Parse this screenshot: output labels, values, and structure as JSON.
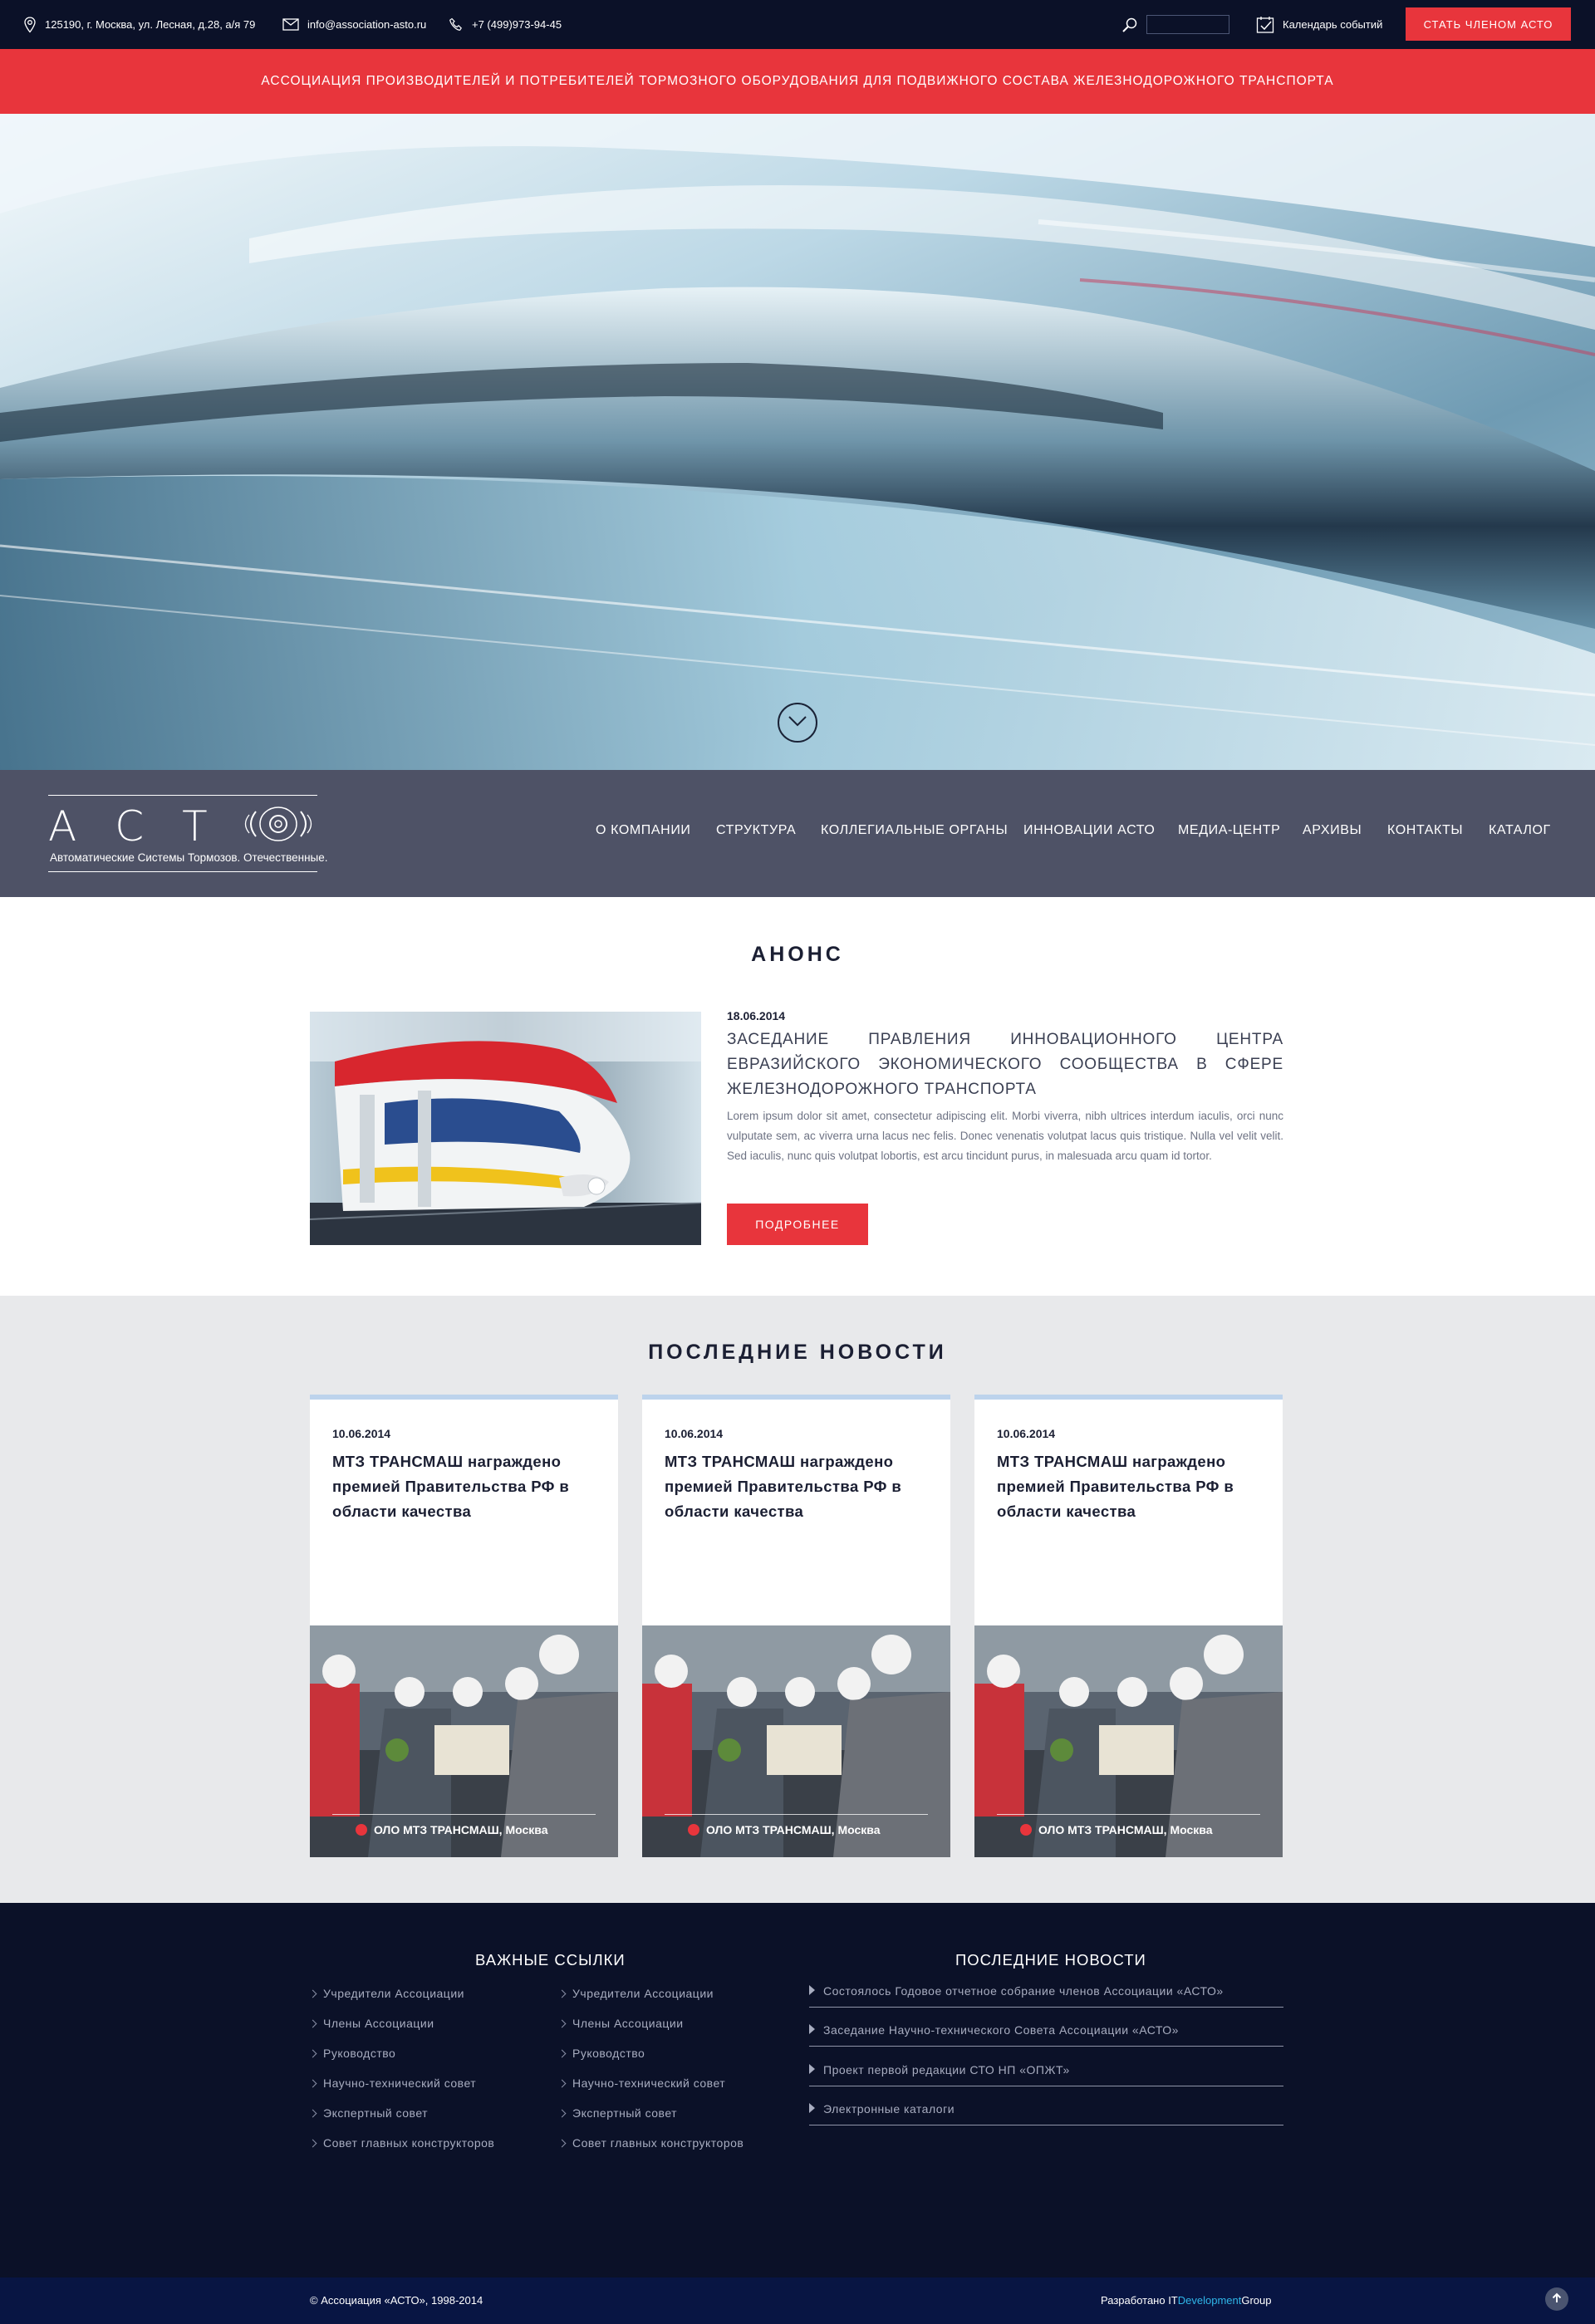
{
  "topbar": {
    "address": "125190, г. Москва, ул. Лесная, д.28, а/я 79",
    "email": "info@association-asto.ru",
    "phone": "+7 (499)973-94-45",
    "search_value": "",
    "calendar_label": "Календарь событий",
    "member_button": "СТАТЬ ЧЛЕНОМ АСТО"
  },
  "banner": {
    "text": "Ассоциация производителей и потребителей тормозного оборудования для подвижного состава железнодорожного транспорта"
  },
  "logo": {
    "letters": "АСТ",
    "tagline": "Автоматические Системы Тормозов. Отечественные."
  },
  "nav": {
    "items": [
      "О КОМПАНИИ",
      "СТРУКТУРА",
      "КОЛЛЕГИАЛЬНЫЕ ОРГАНЫ",
      "ИННОВАЦИИ АСТО",
      "МЕДИА-ЦЕНТР",
      "АРХИВЫ",
      "КОНТАКТЫ",
      "КАТАЛОГ"
    ]
  },
  "announce": {
    "section_title": "АНОНС",
    "date": "18.06.2014",
    "title": "Заседание Правления Инновационного центра Евразийского экономического сообщества в сфере железнодорожного транспорта",
    "text": "Lorem ipsum dolor sit amet, consectetur adipiscing elit. Morbi viverra, nibh ultrices interdum iaculis, orci nunc vulputate sem, ac viverra urna lacus nec felis. Donec venenatis volutpat lacus quis tristique. Nulla vel velit velit. Sed iaculis, nunc quis volutpat lobortis, est arcu tincidunt purus, in malesuada arcu quam id tortor.",
    "button": "ПОДРОБНЕЕ"
  },
  "news": {
    "section_title": "ПОСЛЕДНИЕ НОВОСТИ",
    "cards": [
      {
        "date": "10.06.2014",
        "title": "МТЗ ТРАНСМАШ награждено премией Правительства РФ в области качества",
        "caption": "ОЛО МТЗ ТРАНСМАШ, Москва"
      },
      {
        "date": "10.06.2014",
        "title": "МТЗ ТРАНСМАШ награждено премией Правительства РФ в области качества",
        "caption": "ОЛО МТЗ ТРАНСМАШ, Москва"
      },
      {
        "date": "10.06.2014",
        "title": "МТЗ ТРАНСМАШ награждено премией Правительства РФ в области качества",
        "caption": "ОЛО МТЗ ТРАНСМАШ, Москва"
      }
    ]
  },
  "footer": {
    "links_title": "ВАЖНЫЕ ССЫЛКИ",
    "links_col1": [
      "Учредители Ассоциации",
      "Члены Ассоциации",
      "Руководство",
      "Научно-технический совет",
      "Экспертный совет",
      "Совет главных конструкторов"
    ],
    "links_col2": [
      "Учредители Ассоциации",
      "Члены Ассоциации",
      "Руководство",
      "Научно-технический совет",
      "Экспертный совет",
      "Совет главных конструкторов"
    ],
    "news_title": "ПОСЛЕДНИЕ НОВОСТИ",
    "news": [
      "Состоялось Годовое отчетное собрание членов Ассоциации «АСТО»",
      "Заседание Научно-технического Совета Ассоциации «АСТО»",
      "Проект первой редакции СТО НП «ОПЖТ»",
      "Электронные каталоги"
    ],
    "copyright": "© Ассоциация «АСТО», 1998-2014",
    "dev_prefix": "Разработано IT",
    "dev_accent": "Development",
    "dev_suffix": "Group"
  },
  "colors": {
    "accent_red": "#e8353c",
    "dark_navy": "#0b1128",
    "nav_gray": "#4e5266",
    "news_bg": "#e8e9eb",
    "card_top_border": "#bdd3ec",
    "dev_accent": "#2fb6e8"
  },
  "icons": {
    "address": "location-pin-icon",
    "email": "envelope-icon",
    "phone": "phone-icon",
    "search": "search-icon",
    "calendar": "calendar-check-icon",
    "scroll": "chevron-down-icon",
    "to_top": "arrow-up-icon"
  }
}
